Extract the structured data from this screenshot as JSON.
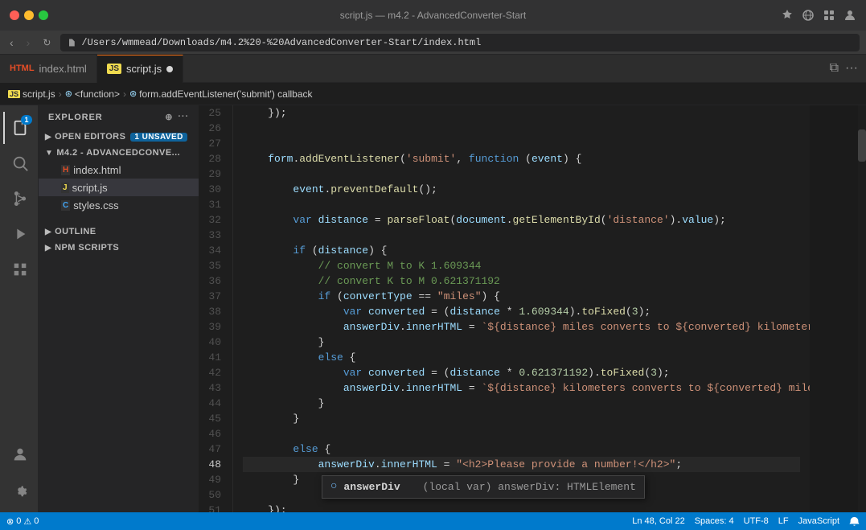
{
  "window": {
    "title": "script.js — m4.2 - AdvancedConverter-Start"
  },
  "titlebar": {
    "url": "/Users/wmmead/Downloads/m4.2%20-%20AdvancedConverter-Start/index.html",
    "traffic_lights": [
      "red",
      "yellow",
      "green"
    ]
  },
  "tabs": [
    {
      "id": "index-html",
      "label": "index.html",
      "icon": "html",
      "active": false,
      "dirty": false
    },
    {
      "id": "script-js",
      "label": "script.js",
      "icon": "js",
      "active": true,
      "dirty": true
    }
  ],
  "breadcrumb": {
    "items": [
      "script.js",
      "<function>",
      "form.addEventListener('submit') callback"
    ]
  },
  "activity_bar": {
    "icons": [
      {
        "id": "explorer",
        "symbol": "⊡",
        "active": true,
        "badge": "1"
      },
      {
        "id": "search",
        "symbol": "🔍",
        "active": false
      },
      {
        "id": "source-control",
        "symbol": "⑂",
        "active": false
      },
      {
        "id": "run-debug",
        "symbol": "▷",
        "active": false
      },
      {
        "id": "extensions",
        "symbol": "⊞",
        "active": false
      }
    ],
    "bottom_icons": [
      {
        "id": "accounts",
        "symbol": "👤"
      },
      {
        "id": "settings",
        "symbol": "⚙"
      }
    ]
  },
  "sidebar": {
    "title": "EXPLORER",
    "open_editors_label": "OPEN EDITORS",
    "open_editors_count": "1 UNSAVED",
    "project_label": "M4.2 - ADVANCEDCONVE...",
    "files": [
      {
        "name": "index.html",
        "icon": "html",
        "indent": 1
      },
      {
        "name": "script.js",
        "icon": "js",
        "indent": 1,
        "active": true
      },
      {
        "name": "styles.css",
        "icon": "css",
        "indent": 1
      }
    ],
    "outline_label": "OUTLINE",
    "npm_label": "NPM SCRIPTS"
  },
  "code": {
    "lines": [
      {
        "num": 25,
        "content": "    });"
      },
      {
        "num": 26,
        "content": ""
      },
      {
        "num": 27,
        "content": ""
      },
      {
        "num": 28,
        "content": "    form.addEventListener('submit', function (event) {",
        "parts": [
          {
            "t": "plain",
            "v": "    "
          },
          {
            "t": "var",
            "v": "form"
          },
          {
            "t": "plain",
            "v": "."
          },
          {
            "t": "method",
            "v": "addEventListener"
          },
          {
            "t": "plain",
            "v": "("
          },
          {
            "t": "str",
            "v": "'submit'"
          },
          {
            "t": "plain",
            "v": ", "
          },
          {
            "t": "kw",
            "v": "function"
          },
          {
            "t": "plain",
            "v": " ("
          },
          {
            "t": "param",
            "v": "event"
          },
          {
            "t": "plain",
            "v": ") {"
          }
        ]
      },
      {
        "num": 29,
        "content": ""
      },
      {
        "num": 30,
        "content": "        event.preventDefault();",
        "parts": [
          {
            "t": "plain",
            "v": "        "
          },
          {
            "t": "var",
            "v": "event"
          },
          {
            "t": "plain",
            "v": "."
          },
          {
            "t": "method",
            "v": "preventDefault"
          },
          {
            "t": "plain",
            "v": "();"
          }
        ]
      },
      {
        "num": 31,
        "content": ""
      },
      {
        "num": 32,
        "content": "        var distance = parseFloat(document.getElementById('distance').value);",
        "parts": [
          {
            "t": "plain",
            "v": "        "
          },
          {
            "t": "kw",
            "v": "var"
          },
          {
            "t": "plain",
            "v": " "
          },
          {
            "t": "var",
            "v": "distance"
          },
          {
            "t": "plain",
            "v": " = "
          },
          {
            "t": "fn",
            "v": "parseFloat"
          },
          {
            "t": "plain",
            "v": "("
          },
          {
            "t": "var",
            "v": "document"
          },
          {
            "t": "plain",
            "v": "."
          },
          {
            "t": "method",
            "v": "getElementById"
          },
          {
            "t": "plain",
            "v": "("
          },
          {
            "t": "str",
            "v": "'distance'"
          },
          {
            "t": "plain",
            "v": ")."
          },
          {
            "t": "prop",
            "v": "value"
          },
          {
            "t": "plain",
            "v": ");"
          }
        ]
      },
      {
        "num": 33,
        "content": ""
      },
      {
        "num": 34,
        "content": "        if (distance) {",
        "parts": [
          {
            "t": "plain",
            "v": "        "
          },
          {
            "t": "kw",
            "v": "if"
          },
          {
            "t": "plain",
            "v": " ("
          },
          {
            "t": "var",
            "v": "distance"
          },
          {
            "t": "plain",
            "v": ") {"
          }
        ]
      },
      {
        "num": 35,
        "content": "            // convert M to K 1.609344",
        "parts": [
          {
            "t": "cm",
            "v": "            // convert M to K 1.609344"
          }
        ]
      },
      {
        "num": 36,
        "content": "            // convert K to M 0.621371192",
        "parts": [
          {
            "t": "cm",
            "v": "            // convert K to M 0.621371192"
          }
        ]
      },
      {
        "num": 37,
        "content": "            if (convertType == \"miles\") {",
        "parts": [
          {
            "t": "plain",
            "v": "            "
          },
          {
            "t": "kw",
            "v": "if"
          },
          {
            "t": "plain",
            "v": " ("
          },
          {
            "t": "var",
            "v": "convertType"
          },
          {
            "t": "plain",
            "v": " == "
          },
          {
            "t": "str",
            "v": "\"miles\""
          },
          {
            "t": "plain",
            "v": ") {"
          }
        ]
      },
      {
        "num": 38,
        "content": "                var converted = (distance * 1.609344).toFixed(3);",
        "parts": [
          {
            "t": "plain",
            "v": "                "
          },
          {
            "t": "kw",
            "v": "var"
          },
          {
            "t": "plain",
            "v": " "
          },
          {
            "t": "var",
            "v": "converted"
          },
          {
            "t": "plain",
            "v": " = ("
          },
          {
            "t": "var",
            "v": "distance"
          },
          {
            "t": "plain",
            "v": " * "
          },
          {
            "t": "num",
            "v": "1.609344"
          },
          {
            "t": "plain",
            "v": ")."
          },
          {
            "t": "method",
            "v": "toFixed"
          },
          {
            "t": "plain",
            "v": "("
          },
          {
            "t": "num",
            "v": "3"
          },
          {
            "t": "plain",
            "v": ");"
          }
        ]
      },
      {
        "num": 39,
        "content": "                answerDiv.innerHTML = `${distance} miles converts to ${converted} kilometers`;",
        "parts": [
          {
            "t": "plain",
            "v": "                "
          },
          {
            "t": "var",
            "v": "answerDiv"
          },
          {
            "t": "plain",
            "v": "."
          },
          {
            "t": "prop",
            "v": "innerHTML"
          },
          {
            "t": "plain",
            "v": " = "
          },
          {
            "t": "tmpl",
            "v": "`${distance} miles converts to ${converted} kilometers`"
          },
          {
            "t": "plain",
            "v": ";"
          }
        ]
      },
      {
        "num": 40,
        "content": "            }"
      },
      {
        "num": 41,
        "content": "            else {",
        "parts": [
          {
            "t": "plain",
            "v": "            "
          },
          {
            "t": "kw",
            "v": "else"
          },
          {
            "t": "plain",
            "v": " {"
          }
        ]
      },
      {
        "num": 42,
        "content": "                var converted = (distance * 0.621371192).toFixed(3);",
        "parts": [
          {
            "t": "plain",
            "v": "                "
          },
          {
            "t": "kw",
            "v": "var"
          },
          {
            "t": "plain",
            "v": " "
          },
          {
            "t": "var",
            "v": "converted"
          },
          {
            "t": "plain",
            "v": " = ("
          },
          {
            "t": "var",
            "v": "distance"
          },
          {
            "t": "plain",
            "v": " * "
          },
          {
            "t": "num",
            "v": "0.621371192"
          },
          {
            "t": "plain",
            "v": ")."
          },
          {
            "t": "method",
            "v": "toFixed"
          },
          {
            "t": "plain",
            "v": "("
          },
          {
            "t": "num",
            "v": "3"
          },
          {
            "t": "plain",
            "v": ");"
          }
        ]
      },
      {
        "num": 43,
        "content": "                answerDiv.innerHTML = `${distance} kilometers converts to ${converted} miles`;",
        "parts": [
          {
            "t": "plain",
            "v": "                "
          },
          {
            "t": "var",
            "v": "answerDiv"
          },
          {
            "t": "plain",
            "v": "."
          },
          {
            "t": "prop",
            "v": "innerHTML"
          },
          {
            "t": "plain",
            "v": " = "
          },
          {
            "t": "tmpl",
            "v": "`${distance} kilometers converts to ${converted} miles`"
          },
          {
            "t": "plain",
            "v": ";"
          }
        ]
      },
      {
        "num": 44,
        "content": "            }"
      },
      {
        "num": 45,
        "content": "        }"
      },
      {
        "num": 46,
        "content": ""
      },
      {
        "num": 47,
        "content": "        else {",
        "parts": [
          {
            "t": "plain",
            "v": "        "
          },
          {
            "t": "kw",
            "v": "else"
          },
          {
            "t": "plain",
            "v": " {"
          }
        ]
      },
      {
        "num": 48,
        "content": "            answerDiv.innerHTML = \"<h2>Please provide a number!</h2>\";",
        "cursor": true,
        "parts": [
          {
            "t": "plain",
            "v": "            "
          },
          {
            "t": "var",
            "v": "answerDiv"
          },
          {
            "t": "plain",
            "v": "."
          },
          {
            "t": "prop",
            "v": "innerHTML"
          },
          {
            "t": "plain",
            "v": " = "
          },
          {
            "t": "str",
            "v": "\"<h2>Please provide a number!</h2>\""
          },
          {
            "t": "plain",
            "v": ";"
          }
        ]
      },
      {
        "num": 49,
        "content": "        }"
      },
      {
        "num": 50,
        "content": ""
      },
      {
        "num": 51,
        "content": "    });"
      }
    ]
  },
  "autocomplete": {
    "icon": "○",
    "label": "answerDiv",
    "type_info": "(local var) answerDiv: HTMLElement"
  },
  "statusbar": {
    "errors": "0",
    "warnings": "0",
    "position": "Ln 48, Col 22",
    "spaces": "Spaces: 4",
    "encoding": "UTF-8",
    "line_ending": "LF",
    "language": "JavaScript",
    "notifications": "🔔"
  }
}
